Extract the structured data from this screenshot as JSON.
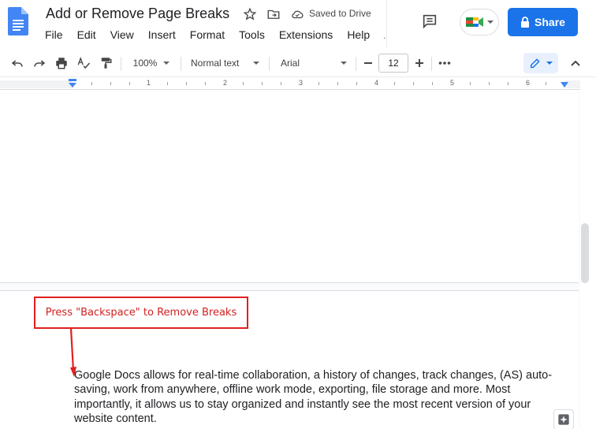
{
  "header": {
    "title": "Add or Remove Page Breaks",
    "saved_status": "Saved to Drive",
    "share_label": "Share"
  },
  "menu": [
    "File",
    "Edit",
    "View",
    "Insert",
    "Format",
    "Tools",
    "Extensions",
    "Help",
    "Acce"
  ],
  "toolbar": {
    "zoom": "100%",
    "style": "Normal text",
    "font": "Arial",
    "font_size": "12"
  },
  "ruler": {
    "numbers": [
      "1",
      "2",
      "3",
      "4",
      "5",
      "6"
    ]
  },
  "annotation": {
    "text": "Press \"Backspace\" to Remove Breaks",
    "color": "#e02020"
  },
  "document": {
    "body": "Google Docs allows for real-time collaboration, a history of changes, track changes, (AS) auto-saving, work from anywhere, offline work mode, exporting, file storage and more. Most importantly, it allows us to stay organized and instantly see the most recent version of your website content."
  },
  "colors": {
    "share_blue": "#1a73e8",
    "docs_blue": "#4285f4"
  }
}
